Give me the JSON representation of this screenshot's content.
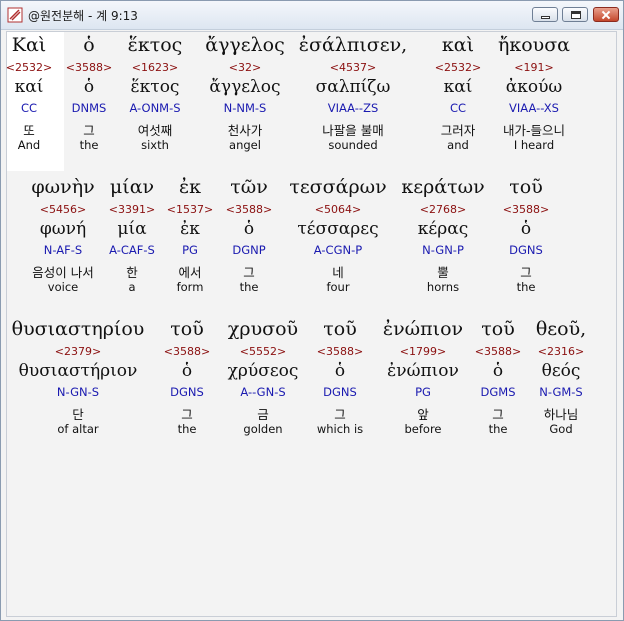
{
  "window": {
    "title": "@원전분해 - 계 9:13"
  },
  "lines": [
    [
      {
        "word": "Καὶ",
        "strong": "<2532>",
        "lemma": "καί",
        "parse": "CC",
        "korean": "또",
        "english": "And"
      },
      {
        "word": "ὁ",
        "strong": "<3588>",
        "lemma": "ὁ",
        "parse": "DNMS",
        "korean": "그",
        "english": "the"
      },
      {
        "word": "ἕκτος",
        "strong": "<1623>",
        "lemma": "ἕκτος",
        "parse": "A-ONM-S",
        "korean": "여섯째",
        "english": "sixth"
      },
      {
        "word": "ἄγγελος",
        "strong": "<32>",
        "lemma": "ἄγγελος",
        "parse": "N-NM-S",
        "korean": "천사가",
        "english": "angel"
      },
      {
        "word": "ἐσάλπισεν,",
        "strong": "<4537>",
        "lemma": "σαλπίζω",
        "parse": "VIAA--ZS",
        "korean": "나팔을 불매",
        "english": "sounded"
      },
      {
        "word": "καὶ",
        "strong": "<2532>",
        "lemma": "καί",
        "parse": "CC",
        "korean": "그러자",
        "english": "and"
      },
      {
        "word": "ἤκουσα",
        "strong": "<191>",
        "lemma": "ἀκούω",
        "parse": "VIAA--XS",
        "korean": "내가-들으니",
        "english": "I heard"
      }
    ],
    [
      {
        "word": "φωνὴν",
        "strong": "<5456>",
        "lemma": "φωνή",
        "parse": "N-AF-S",
        "korean": "음성이 나서",
        "english": "voice"
      },
      {
        "word": "μίαν",
        "strong": "<3391>",
        "lemma": "μία",
        "parse": "A-CAF-S",
        "korean": "한",
        "english": "a"
      },
      {
        "word": "ἐκ",
        "strong": "<1537>",
        "lemma": "ἐκ",
        "parse": "PG",
        "korean": "에서",
        "english": "form"
      },
      {
        "word": "τῶν",
        "strong": "<3588>",
        "lemma": "ὁ",
        "parse": "DGNP",
        "korean": "그",
        "english": "the"
      },
      {
        "word": "τεσσάρων",
        "strong": "<5064>",
        "lemma": "τέσσαρες",
        "parse": "A-CGN-P",
        "korean": "네",
        "english": "four"
      },
      {
        "word": "κεράτων",
        "strong": "<2768>",
        "lemma": "κέρας",
        "parse": "N-GN-P",
        "korean": "뿔",
        "english": "horns"
      },
      {
        "word": "τοῦ",
        "strong": "<3588>",
        "lemma": "ὁ",
        "parse": "DGNS",
        "korean": "그",
        "english": "the"
      }
    ],
    [
      {
        "word": "θυσιαστηρίου",
        "strong": "<2379>",
        "lemma": "θυσιαστήριον",
        "parse": "N-GN-S",
        "korean": "단",
        "english": "of altar"
      },
      {
        "word": "τοῦ",
        "strong": "<3588>",
        "lemma": "ὁ",
        "parse": "DGNS",
        "korean": "그",
        "english": "the"
      },
      {
        "word": "χρυσοῦ",
        "strong": "<5552>",
        "lemma": "χρύσεος",
        "parse": "A--GN-S",
        "korean": "금",
        "english": "golden"
      },
      {
        "word": "τοῦ",
        "strong": "<3588>",
        "lemma": "ὁ",
        "parse": "DGNS",
        "korean": "그",
        "english": "which is"
      },
      {
        "word": "ἐνώπιον",
        "strong": "<1799>",
        "lemma": "ἐνώπιον",
        "parse": "PG",
        "korean": "앞",
        "english": "before"
      },
      {
        "word": "τοῦ",
        "strong": "<3588>",
        "lemma": "ὁ",
        "parse": "DGMS",
        "korean": "그",
        "english": "the"
      },
      {
        "word": "θεοῦ,",
        "strong": "<2316>",
        "lemma": "θεός",
        "parse": "N-GM-S",
        "korean": "하나님",
        "english": "God"
      }
    ]
  ]
}
